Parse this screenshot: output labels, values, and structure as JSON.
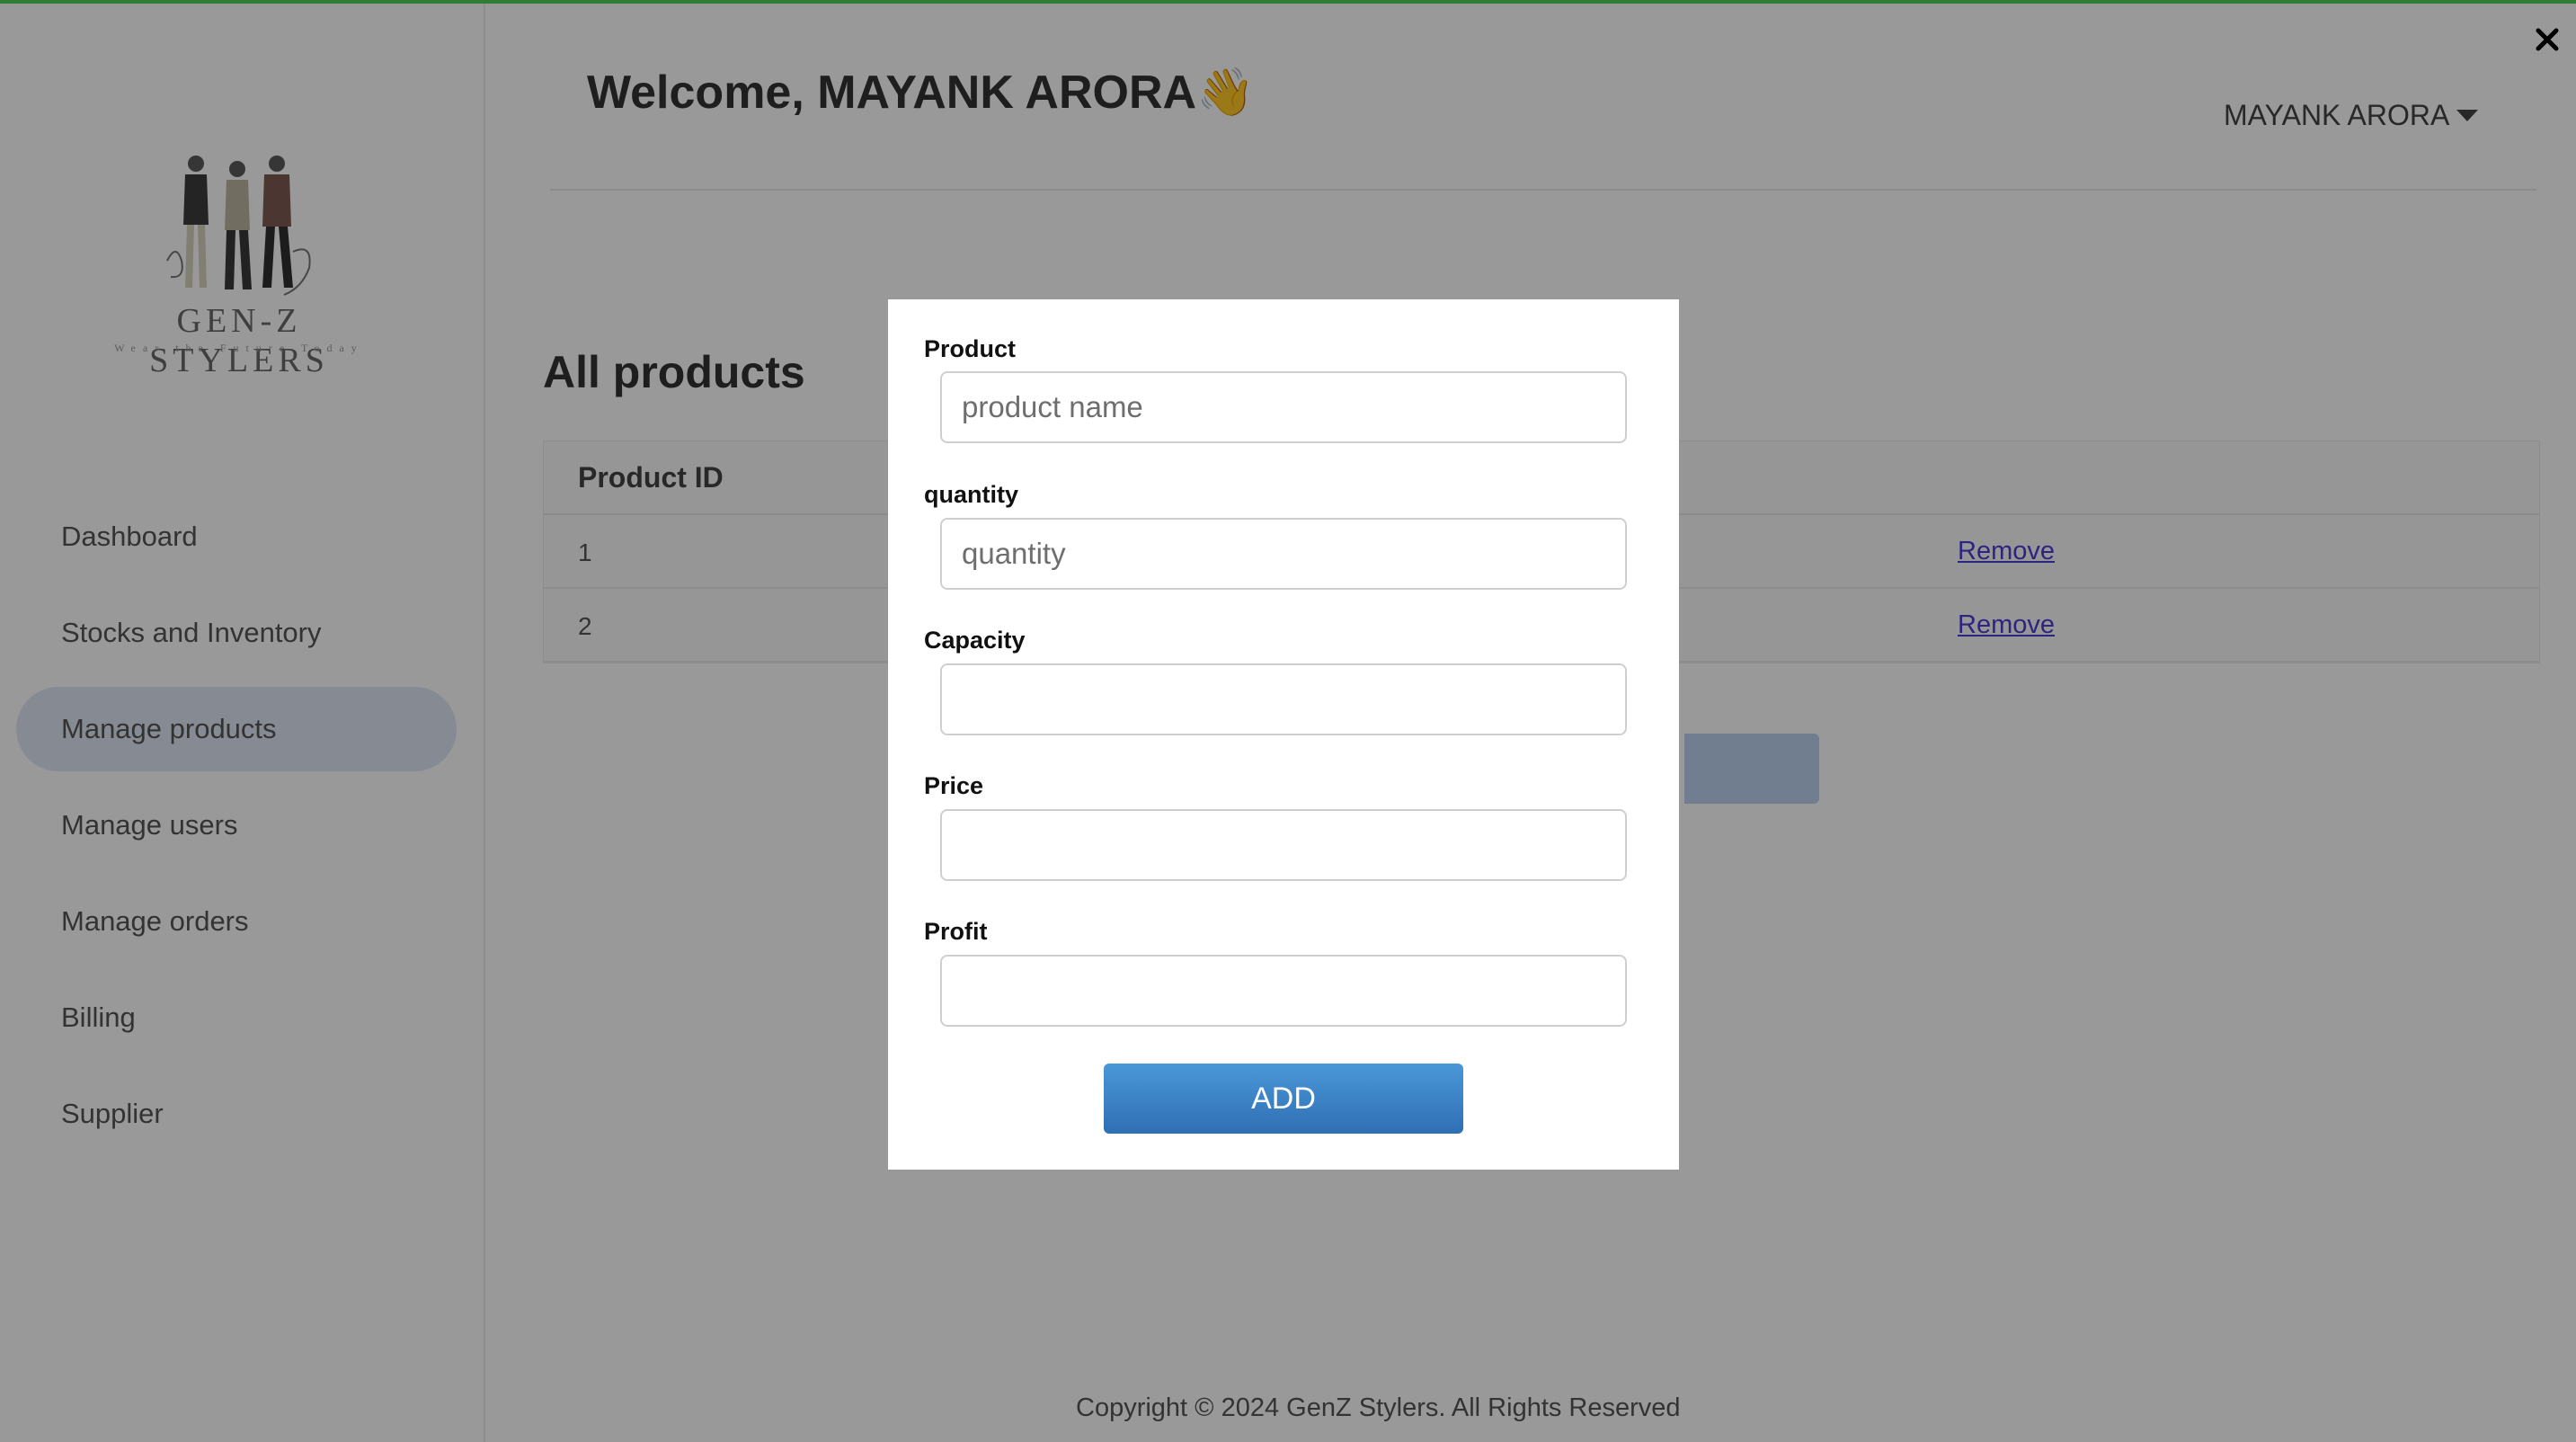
{
  "brand": {
    "name": "GEN-Z STYLERS",
    "tagline": "Wear the Future Today"
  },
  "header": {
    "welcome": "Welcome, MAYANK ARORA👋",
    "user_menu": "MAYANK ARORA"
  },
  "sidebar": {
    "items": [
      {
        "label": "Dashboard",
        "active": false
      },
      {
        "label": "Stocks and Inventory",
        "active": false
      },
      {
        "label": "Manage products",
        "active": true
      },
      {
        "label": "Manage users",
        "active": false
      },
      {
        "label": "Manage orders",
        "active": false
      },
      {
        "label": "Billing",
        "active": false
      },
      {
        "label": "Supplier",
        "active": false
      }
    ]
  },
  "main": {
    "section_title": "All products",
    "table": {
      "headers": [
        "Product ID"
      ],
      "rows": [
        {
          "id": "1",
          "action": "Remove"
        },
        {
          "id": "2",
          "action": "Remove"
        }
      ]
    }
  },
  "modal": {
    "fields": [
      {
        "label": "Product",
        "placeholder": "product name",
        "value": ""
      },
      {
        "label": "quantity",
        "placeholder": "quantity",
        "value": ""
      },
      {
        "label": "Capacity",
        "placeholder": "",
        "value": ""
      },
      {
        "label": "Price",
        "placeholder": "",
        "value": ""
      },
      {
        "label": "Profit",
        "placeholder": "",
        "value": ""
      }
    ],
    "submit_label": "ADD",
    "close_icon": "close-icon"
  },
  "footer": {
    "copyright": "Copyright © 2024 GenZ Stylers. All Rights Reserved"
  },
  "colors": {
    "accent": "#2e7d32",
    "active_nav": "#dfe6f6",
    "button": "#3a85c8",
    "link": "#4a3cd6"
  }
}
